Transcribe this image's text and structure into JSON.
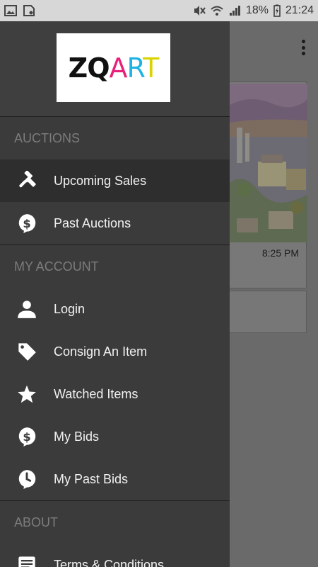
{
  "status_bar": {
    "battery_percent": "18%",
    "time": "21:24",
    "icons": [
      "image-icon",
      "sd-card-icon",
      "mute-icon",
      "wifi-icon",
      "signal-icon",
      "battery-charging-icon"
    ]
  },
  "background": {
    "card_time": "8:25 PM",
    "menu_icon": "overflow-menu-icon"
  },
  "drawer": {
    "logo": "ZQART",
    "sections": [
      {
        "title": "AUCTIONS",
        "items": [
          {
            "label": "Upcoming Sales",
            "icon": "gavel-icon",
            "active": true
          },
          {
            "label": "Past Auctions",
            "icon": "dollar-bubble-icon",
            "active": false
          }
        ]
      },
      {
        "title": "MY ACCOUNT",
        "items": [
          {
            "label": "Login",
            "icon": "person-icon",
            "active": false
          },
          {
            "label": "Consign An Item",
            "icon": "tag-icon",
            "active": false
          },
          {
            "label": "Watched Items",
            "icon": "star-icon",
            "active": false
          },
          {
            "label": "My Bids",
            "icon": "dollar-bubble-icon",
            "active": false
          },
          {
            "label": "My Past Bids",
            "icon": "clock-bubble-icon",
            "active": false
          }
        ]
      },
      {
        "title": "ABOUT",
        "items": [
          {
            "label": "Terms & Conditions",
            "icon": "document-icon",
            "active": false
          }
        ]
      }
    ]
  },
  "colors": {
    "drawer_bg": "#3b3b3b",
    "active_bg": "#2e2e2e",
    "section_text": "#7c7c7c",
    "item_text": "#f2f2f2"
  }
}
